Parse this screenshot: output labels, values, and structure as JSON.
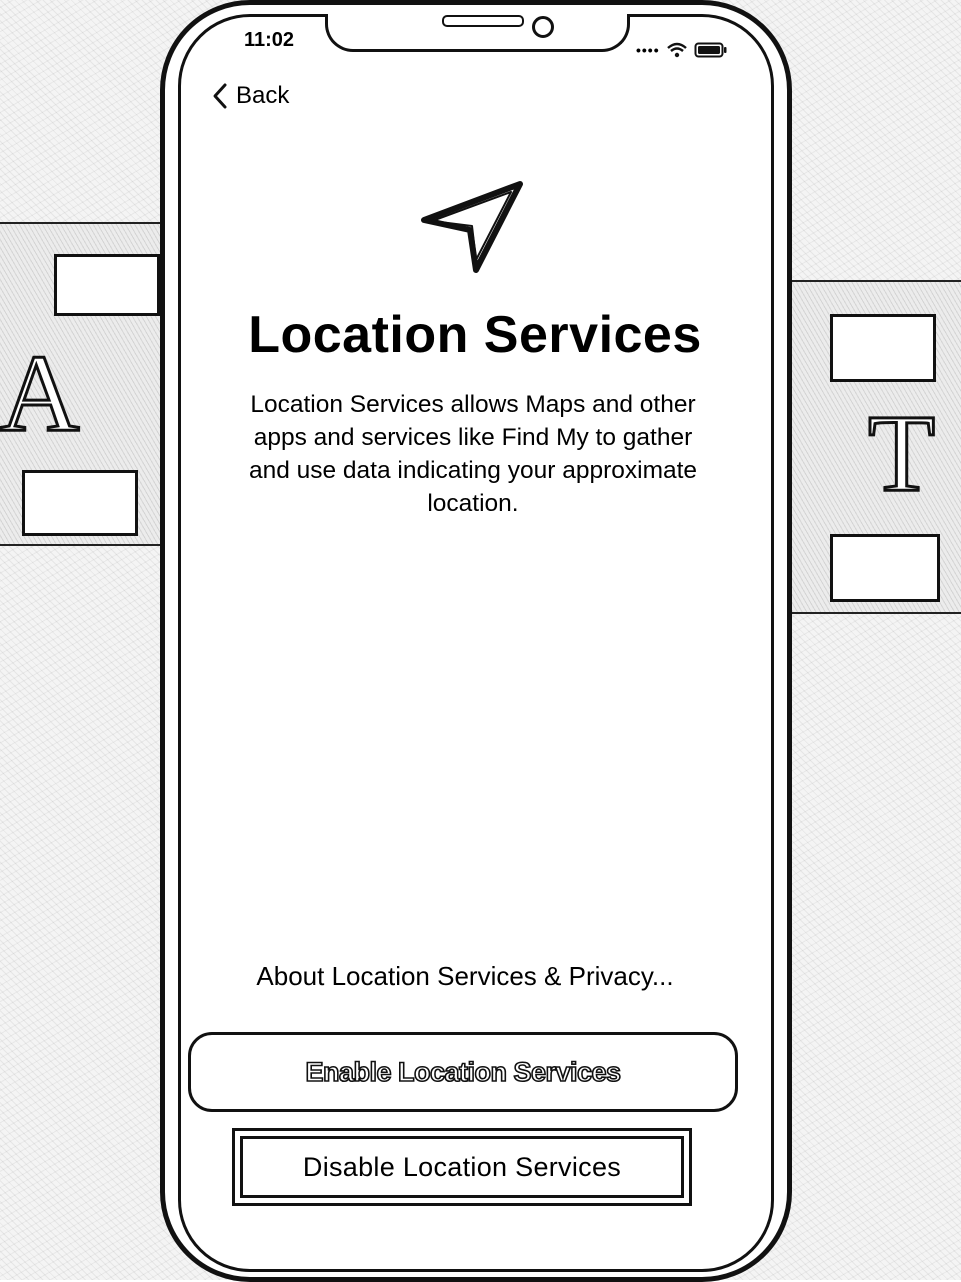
{
  "status_bar": {
    "time": "11:02",
    "signal_icon": "cellular-signal-icon",
    "wifi_icon": "wifi-icon",
    "battery_icon": "battery-icon"
  },
  "navigation": {
    "back_label": "Back",
    "back_icon": "chevron-left-icon"
  },
  "main": {
    "hero_icon": "location-arrow-icon",
    "title": "Location Services",
    "description_lines": [
      "Location Services allows Maps and other",
      "apps and services like Find My to gather",
      "and use data indicating your approximate",
      "location."
    ],
    "privacy_link": "About Location Services & Privacy..."
  },
  "actions": {
    "enable_label": "Enable Location Services",
    "disable_label": "Disable Location Services"
  },
  "backdrop": {
    "letters": [
      "A",
      "T"
    ]
  }
}
